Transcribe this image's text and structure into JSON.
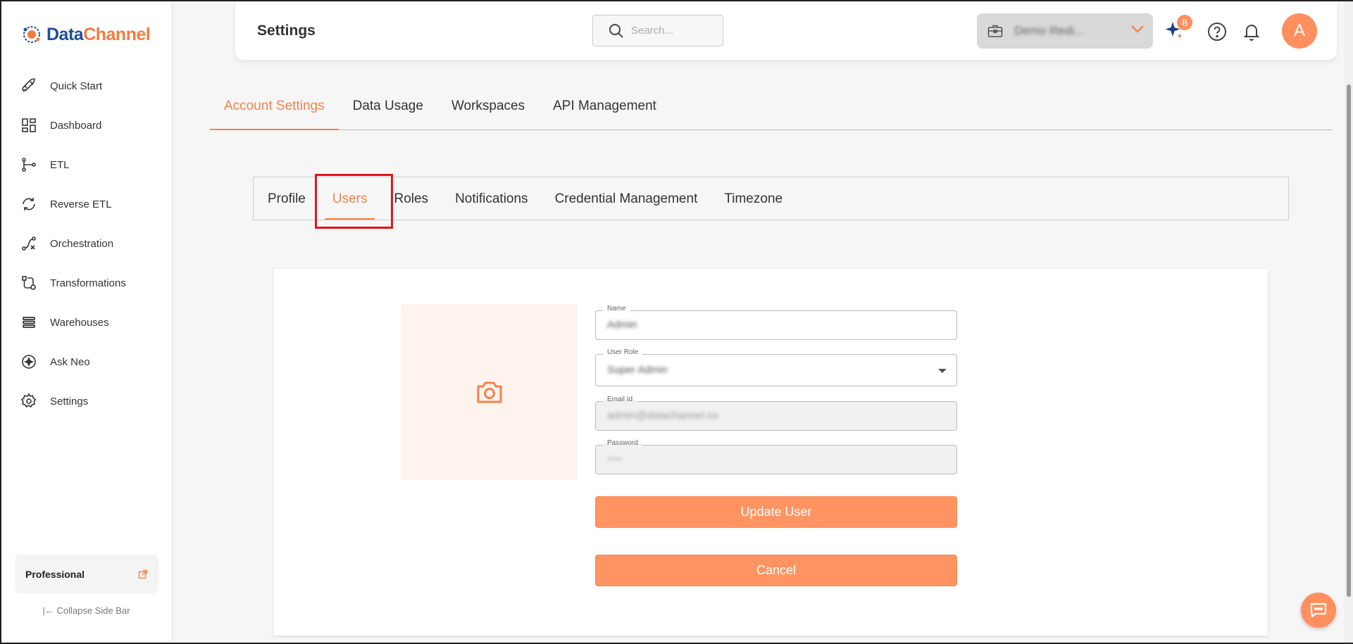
{
  "brand": {
    "name_part1": "Data",
    "name_part2": "Channel"
  },
  "sidebar": {
    "items": [
      {
        "label": "Quick Start",
        "icon": "rocket-icon"
      },
      {
        "label": "Dashboard",
        "icon": "dashboard-grid-icon"
      },
      {
        "label": "ETL",
        "icon": "etl-flow-icon"
      },
      {
        "label": "Reverse ETL",
        "icon": "reverse-etl-icon"
      },
      {
        "label": "Orchestration",
        "icon": "orchestration-icon"
      },
      {
        "label": "Transformations",
        "icon": "transformations-icon"
      },
      {
        "label": "Warehouses",
        "icon": "warehouse-stack-icon"
      },
      {
        "label": "Ask Neo",
        "icon": "sparkle-circle-icon"
      },
      {
        "label": "Settings",
        "icon": "gear-icon"
      }
    ],
    "plan_label": "Professional",
    "collapse_label": "Collapse Side Bar"
  },
  "header": {
    "title": "Settings",
    "search_placeholder": "Search...",
    "workspace_name": "Demo Redi...",
    "notification_badge": "8",
    "avatar_letter": "A"
  },
  "main_tabs": [
    {
      "label": "Account Settings",
      "active": true
    },
    {
      "label": "Data Usage",
      "active": false
    },
    {
      "label": "Workspaces",
      "active": false
    },
    {
      "label": "API Management",
      "active": false
    }
  ],
  "sub_tabs": [
    {
      "label": "Profile",
      "active": false
    },
    {
      "label": "Users",
      "active": true
    },
    {
      "label": "Roles",
      "active": false
    },
    {
      "label": "Notifications",
      "active": false
    },
    {
      "label": "Credential Management",
      "active": false
    },
    {
      "label": "Timezone",
      "active": false
    }
  ],
  "form": {
    "name_label": "Name",
    "name_value": "Admin",
    "role_label": "User Role",
    "role_value": "Super Admin",
    "email_label": "Email Id",
    "email_value": "admin@datachannel.co",
    "password_label": "Password",
    "password_value": "••••",
    "update_label": "Update User",
    "cancel_label": "Cancel"
  },
  "colors": {
    "accent": "#f2834d",
    "button": "#ff9462",
    "highlight": "#e0161d"
  }
}
